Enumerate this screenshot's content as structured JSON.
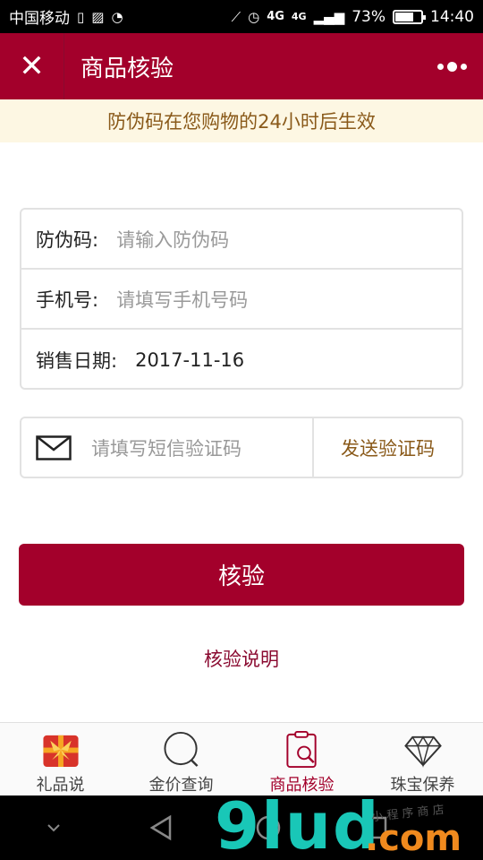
{
  "status_bar": {
    "carrier": "中国移动",
    "network": "4G",
    "network2": "4G",
    "battery_percent": "73%",
    "battery_level": 0.73,
    "time": "14:40"
  },
  "header": {
    "close_icon": "close-icon",
    "title": "商品核验",
    "more_icon": "more-dots-icon"
  },
  "notice": {
    "text": "防伪码在您购物的24小时后生效"
  },
  "form": {
    "rows": [
      {
        "label": "防伪码:",
        "placeholder": "请输入防伪码",
        "value": ""
      },
      {
        "label": "手机号:",
        "placeholder": "请填写手机号码",
        "value": ""
      },
      {
        "label": "销售日期:",
        "placeholder": "",
        "value": "2017-11-16"
      }
    ],
    "sms": {
      "icon": "mail-icon",
      "placeholder": "请填写短信验证码",
      "send_label": "发送验证码"
    }
  },
  "actions": {
    "verify_label": "核验",
    "explain_label": "核验说明"
  },
  "tabbar": {
    "items": [
      {
        "label": "礼品说",
        "icon": "gift-icon",
        "active": false
      },
      {
        "label": "金价查询",
        "icon": "search-icon",
        "active": false
      },
      {
        "label": "商品核验",
        "icon": "clipboard-search-icon",
        "active": true
      },
      {
        "label": "珠宝保养",
        "icon": "diamond-icon",
        "active": false
      }
    ]
  },
  "navbar": {
    "items": [
      "chevron-down-icon",
      "back-icon",
      "home-icon",
      "recents-icon"
    ]
  },
  "watermark": {
    "main": "9lud",
    "suffix": ".com",
    "small": "小 程 序 商 店"
  },
  "colors": {
    "brand": "#a3002b",
    "notice_bg": "#fdf7e3",
    "notice_text": "#8a5a1a",
    "watermark_cyan": "#19c7b7",
    "watermark_orange": "#f08a1e"
  }
}
